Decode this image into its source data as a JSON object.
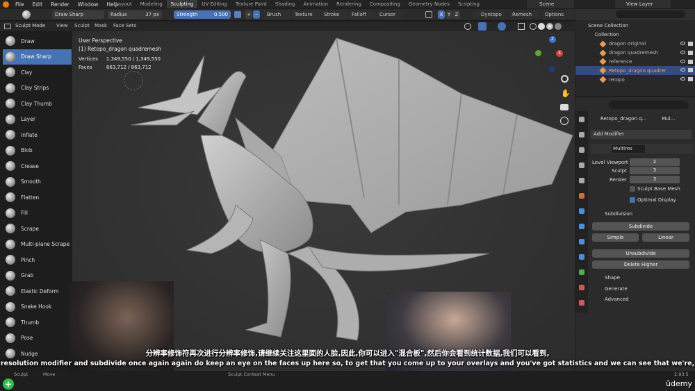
{
  "menu": {
    "items": [
      "File",
      "Edit",
      "Render",
      "Window",
      "Help"
    ],
    "workspaces": [
      "Layout",
      "Modeling",
      "Sculpting",
      "UV Editing",
      "Texture Paint",
      "Shading",
      "Animation",
      "Rendering",
      "Compositing",
      "Geometry Nodes",
      "Scripting"
    ],
    "active_workspace": "Sculpting",
    "scene": "Scene",
    "view_layer": "View Layer"
  },
  "tool_header": {
    "brush_name": "Draw Sharp",
    "radius_label": "Radius",
    "radius_value": "37 px",
    "strength_label": "Strength",
    "strength_value": "0.500",
    "brush": "Brush",
    "texture": "Texture",
    "stroke": "Stroke",
    "falloff": "Falloff",
    "cursor": "Cursor",
    "axes": [
      "X",
      "Y",
      "Z"
    ],
    "dyntopo": "Dyntopo",
    "remesh": "Remesh",
    "options": "Options"
  },
  "header2": {
    "mode": "Sculpt Mode",
    "menus": [
      "View",
      "Sculpt",
      "Mask",
      "Face Sets"
    ]
  },
  "tools": [
    "Draw",
    "Draw Sharp",
    "Clay",
    "Clay Strips",
    "Clay Thumb",
    "Layer",
    "Inflate",
    "Blob",
    "Crease",
    "Smooth",
    "Flatten",
    "Fill",
    "Scrape",
    "Multi-plane Scrape",
    "Pinch",
    "Grab",
    "Elastic Deform",
    "Snake Hook",
    "Thumb",
    "Pose",
    "Nudge"
  ],
  "active_tool": "Draw Sharp",
  "viewport": {
    "perspective": "User Perspective",
    "object": "(1) Retopo_dragon quadremesh",
    "vertices_label": "Vertices",
    "vertices": "1,349,550 / 1,349,550",
    "faces_label": "Faces",
    "faces": "863,712 / 863,712"
  },
  "outliner": {
    "scene_collection": "Scene Collection",
    "collection": "Collection",
    "items": [
      "dragon original",
      "dragon quadremesh",
      "reference",
      "Retopo_dragon quadrer",
      "retopo"
    ],
    "selected": "Retopo_dragon quadrer"
  },
  "properties": {
    "object_name": "Retopo_dragon q...",
    "modifier_short": "Mul...",
    "add_modifier": "Add Modifier",
    "modifier_name": "Multires",
    "level_viewport_label": "Level Viewport",
    "level_viewport": "2",
    "sculpt_label": "Sculpt",
    "sculpt": "3",
    "render_label": "Render",
    "render": "3",
    "sculpt_base_mesh": "Sculpt Base Mesh",
    "optimal_display": "Optimal Display",
    "subdivision": "Subdivision",
    "subdivide": "Subdivide",
    "simple": "Simple",
    "linear": "Linear",
    "unsubdivide": "Unsubdivide",
    "delete_higher": "Delete Higher",
    "shape": "Shape",
    "generate": "Generate",
    "advanced": "Advanced"
  },
  "subtitles": {
    "chinese": "分辨率修饰符再次进行分辨率修饰,请继续关注这里面的人脸,因此,你可以进入\"混合板\",然后你会看到统计数据,我们可以看到,",
    "english": "resolution modifier and subdivide once again again do keep an eye on the faces up here so, to get that you come up to your overlays and you've got statistics and we can see that we're,"
  },
  "status_bar": {
    "left": "Sculpt",
    "move": "Move",
    "center": "Sculpt Context Menu",
    "version": "2.93.5",
    "brand": "ûdemy"
  },
  "colors": {
    "accent": "#4772b3",
    "selected_text": "#f0a060"
  }
}
